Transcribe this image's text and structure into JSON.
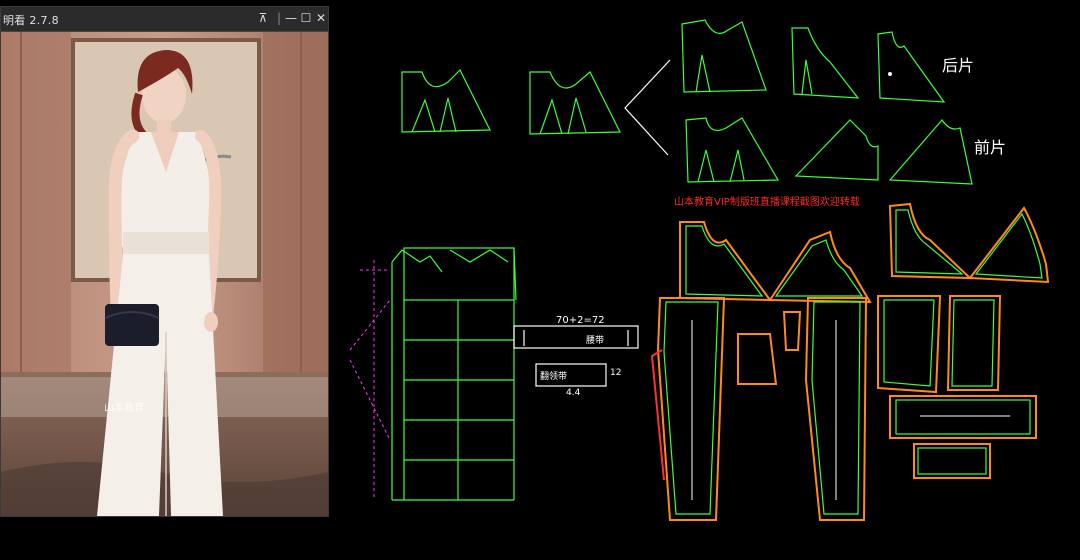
{
  "viewer": {
    "title": "明看 2.7.8",
    "buttons": {
      "pin": "⊼",
      "minimize": "—",
      "maximize": "☐",
      "close": "✕"
    },
    "watermark": "山本教育"
  },
  "cad": {
    "back_label": "后片",
    "front_label": "前片",
    "banner": "山本教育VIP制版班直播课程截图欢迎转载",
    "formula": "70+2=72",
    "waist_label": "腰带",
    "sash_label": "翻领带",
    "sash_height": "12",
    "sash_width": "4.4"
  },
  "colors": {
    "pattern_green": "#3cff3c",
    "seam_orange": "#ff8a1a",
    "seam_red": "#ff3030",
    "magenta": "#ff33ff",
    "banner_red": "#ff2a2a"
  }
}
